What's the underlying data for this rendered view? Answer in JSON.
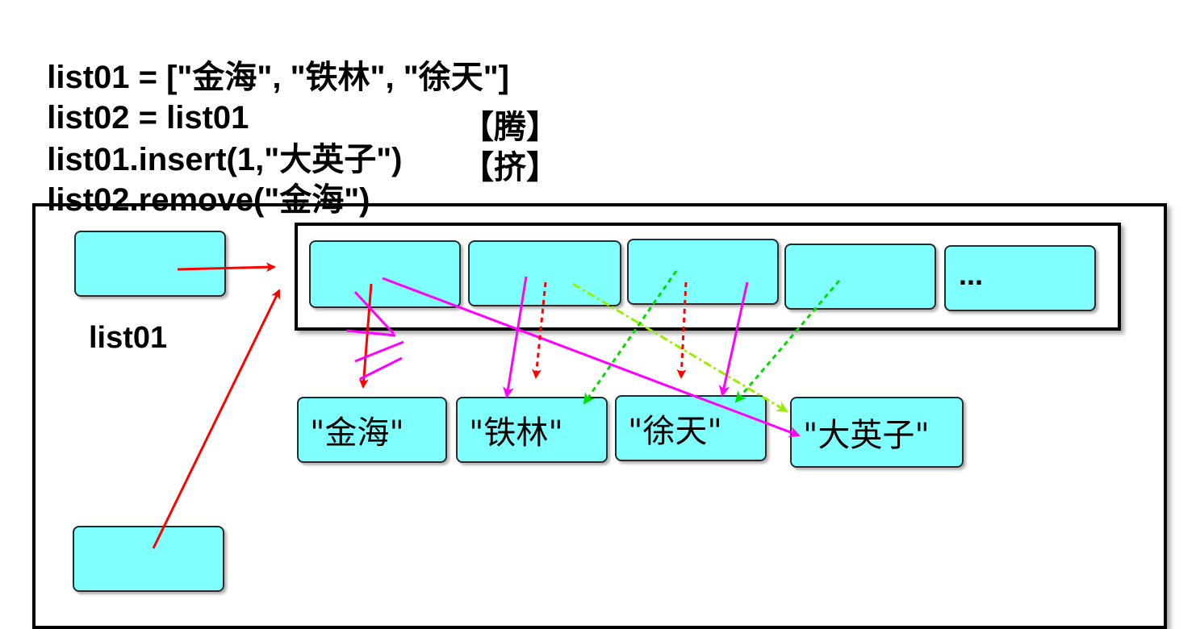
{
  "code": {
    "line1": "list01 = [\"金海\", \"铁林\", \"徐天\"]",
    "line2": "list02 = list01",
    "line3": "list01.insert(1,\"大英子\")",
    "line4": "list02.remove(\"金海\")",
    "note3": "【腾】",
    "note4": "【挤】"
  },
  "diagram": {
    "var_label_list01": "list01",
    "ellipsis": "...",
    "values": [
      "\"金海\"",
      "\"铁林\"",
      "\"徐天\"",
      "\"大英子\""
    ],
    "colors": {
      "cell_fill": "#80ffff",
      "arrow_red": "#ff0000",
      "arrow_magenta": "#ff00ff",
      "arrow_green": "#00dd00",
      "arrow_yellow_green": "#99ee00"
    }
  }
}
